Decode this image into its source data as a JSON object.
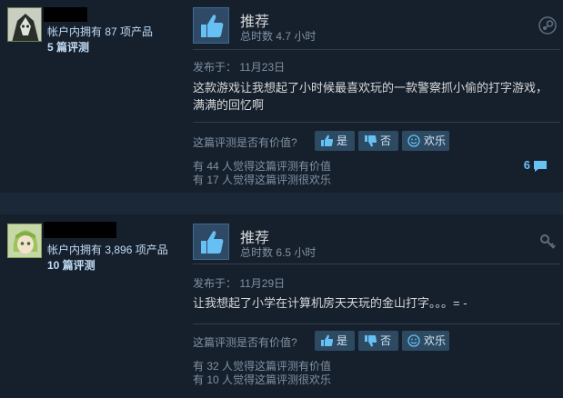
{
  "reviews": [
    {
      "owned": "帐户内拥有 87 项产品",
      "reviews_count": "5 篇评测",
      "recommendation": "推荐",
      "hours": "总时数 4.7 小时",
      "posted": "发布于：  11月23日",
      "content": "这款游戏让我想起了小时候最喜欢玩的一款警察抓小偷的打字游戏，满满的回忆啊",
      "helpful_question": "这篇评测是否有价值?",
      "yes_label": "是",
      "no_label": "否",
      "funny_label": "欢乐",
      "helpful_count": "有 44 人觉得这篇评测有价值",
      "funny_count": "有 17 人觉得这篇评测很欢乐",
      "comment_count": "6",
      "corner_icon": "steam-icon"
    },
    {
      "owned": "帐户内拥有 3,896 项产品",
      "reviews_count": "10 篇评测",
      "recommendation": "推荐",
      "hours": "总时数 6.5 小时",
      "posted": "发布于：  11月29日",
      "content": "让我想起了小学在计算机房天天玩的金山打字。。。= -",
      "helpful_question": "这篇评测是否有价值?",
      "yes_label": "是",
      "no_label": "否",
      "funny_label": "欢乐",
      "helpful_count": "有 32 人觉得这篇评测有价值",
      "funny_count": "有 10 人觉得这篇评测很欢乐",
      "corner_icon": "key-icon"
    }
  ],
  "colors": {
    "background": "#1b2838",
    "review_bg": "#16202d",
    "accent": "#67c1f5",
    "button": "#2d4a63"
  }
}
